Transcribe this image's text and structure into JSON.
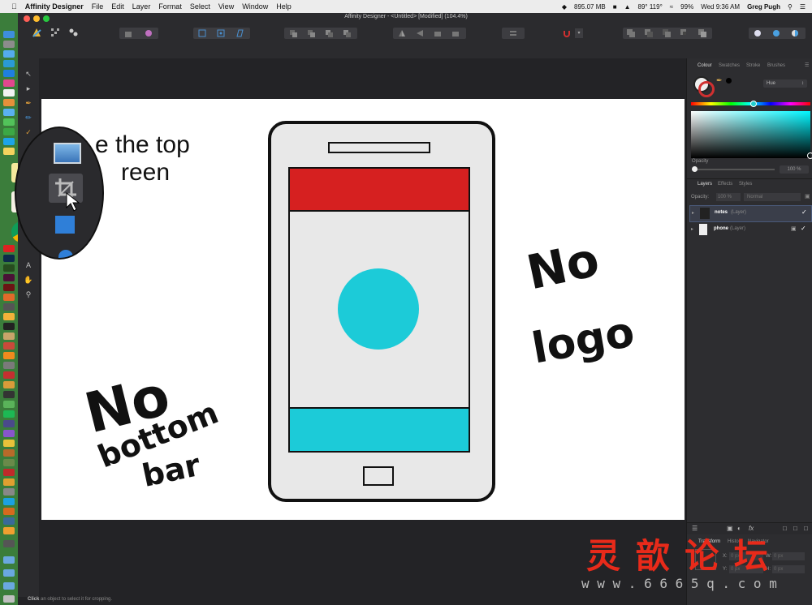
{
  "menubar": {
    "app_name": "Affinity Designer",
    "items": [
      "File",
      "Edit",
      "Layer",
      "Format",
      "Select",
      "View",
      "Window",
      "Help"
    ],
    "memory": "895.07 MB",
    "temperature": "89° 119°",
    "battery": "99%",
    "clock": "Wed 9:36 AM",
    "user": "Greg Pugh"
  },
  "window": {
    "title": "Affinity Designer - <Untitled> [Modified] (104.4%)"
  },
  "canvas": {
    "partial_text_line1": "e the top",
    "partial_text_line2": "reen",
    "note_right_line1": "No",
    "note_right_line2": "logo",
    "note_left_line1": "No",
    "note_left_line2": "bottom",
    "note_left_line3": "bar"
  },
  "phone": {
    "top_bar_color": "#d62020",
    "circle_color": "#1ccbd8",
    "bottom_bar_color": "#1ccbd8",
    "screen_color": "#e8e8e8"
  },
  "panel": {
    "tabs_top": [
      "Colour",
      "Swatches",
      "Stroke",
      "Brushes"
    ],
    "color_mode": "Hue",
    "opacity_label": "Opacity",
    "opacity_value": "100 %",
    "layer_tabs": [
      "Layers",
      "Effects",
      "Styles"
    ],
    "layer_opacity_label": "Opacity:",
    "layer_opacity_value": "100 %",
    "blend_mode": "Normal",
    "layers": [
      {
        "name": "notes",
        "type": "(Layer)"
      },
      {
        "name": "phone",
        "type": "(Layer)"
      }
    ],
    "bottom_tabs": [
      "Transform",
      "History",
      "Navigator"
    ],
    "transform_fields": [
      {
        "label": "X:",
        "value": "0 px"
      },
      {
        "label": "W:",
        "value": "0 px"
      },
      {
        "label": "Y:",
        "value": "0 px"
      },
      {
        "label": "H:",
        "value": "0 px"
      }
    ]
  },
  "watermark": {
    "chars": "灵 歆 论 坛",
    "url": "w w w . 6 6 6 5 q . c o m"
  },
  "status": {
    "text_bold": "Click",
    "text_rest": "an object to select it for cropping."
  }
}
